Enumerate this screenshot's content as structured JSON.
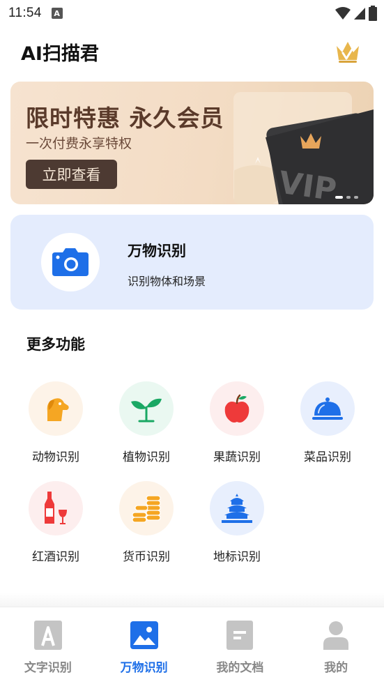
{
  "status_bar": {
    "time": "11:54",
    "notification_icon": "A"
  },
  "header": {
    "title": "AI扫描君",
    "vip_icon": "crown-icon"
  },
  "banner": {
    "title": "限时特惠 永久会员",
    "subtitle": "一次付费永享特权",
    "cta": "立即查看",
    "card_text": "VIP",
    "pages": 3,
    "active_page": 1
  },
  "main_feature": {
    "title": "万物识别",
    "subtitle": "识别物体和场景",
    "icon": "camera-icon"
  },
  "more": {
    "title": "更多功能",
    "items": [
      {
        "label": "动物识别",
        "icon": "dog-icon",
        "bg": "#fdf3e8"
      },
      {
        "label": "植物识别",
        "icon": "sprout-icon",
        "bg": "#eaf8f1"
      },
      {
        "label": "果蔬识别",
        "icon": "apple-icon",
        "bg": "#fdeeee"
      },
      {
        "label": "菜品识别",
        "icon": "dish-cover-icon",
        "bg": "#e8effd"
      },
      {
        "label": "红酒识别",
        "icon": "wine-icon",
        "bg": "#fdeeee"
      },
      {
        "label": "货币识别",
        "icon": "coins-icon",
        "bg": "#fdf3e8"
      },
      {
        "label": "地标识别",
        "icon": "temple-icon",
        "bg": "#e8effd"
      }
    ]
  },
  "bottom_nav": {
    "items": [
      {
        "label": "文字识别",
        "icon": "text-a-icon",
        "active": false
      },
      {
        "label": "万物识别",
        "icon": "image-icon",
        "active": true
      },
      {
        "label": "我的文档",
        "icon": "document-icon",
        "active": false
      },
      {
        "label": "我的",
        "icon": "person-icon",
        "active": false
      }
    ]
  },
  "colors": {
    "accent": "#1e6fe8",
    "banner_dark": "#4d3a32",
    "card_bg": "#e4ecfd"
  }
}
